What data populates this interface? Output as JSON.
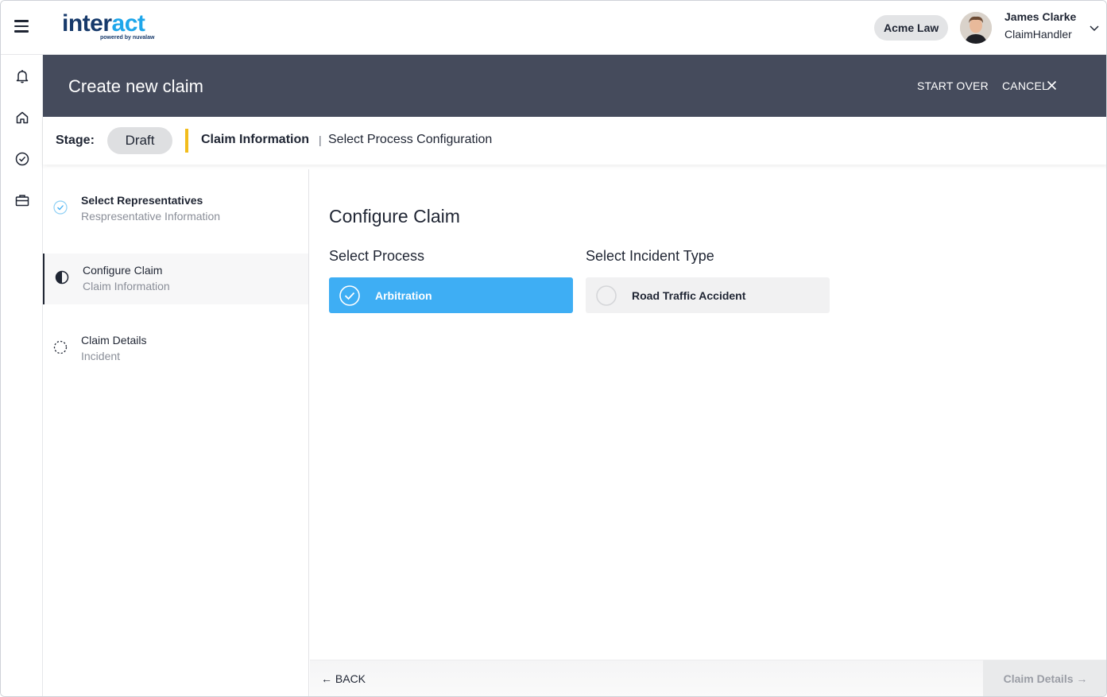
{
  "app": {
    "logo_primary": "inter",
    "logo_accent": "act",
    "logo_tagline": "powered by nuvalaw",
    "brand_colors": {
      "primary": "#173a6b",
      "accent": "#1ea6ea"
    }
  },
  "topbar": {
    "menu_icon": "hamburger-icon",
    "organization": "Acme Law",
    "user": {
      "name": "James Clarke",
      "role": "ClaimHandler"
    },
    "user_menu_icon": "chevron-down-icon"
  },
  "rail": {
    "items": [
      {
        "icon": "bell-icon"
      },
      {
        "icon": "home-icon"
      },
      {
        "icon": "check-circle-icon"
      },
      {
        "icon": "briefcase-icon"
      }
    ]
  },
  "header": {
    "title": "Create new claim",
    "start_over": "START OVER",
    "cancel": "CANCEL",
    "cancel_icon": "close-icon",
    "background": "#454b5c"
  },
  "stage": {
    "label": "Stage:",
    "value": "Draft",
    "accent": "#f2bd1d",
    "breadcrumb": [
      "Claim Information",
      "|",
      "Select Process Configuration"
    ]
  },
  "steps": [
    {
      "title": "Select Representatives",
      "subtitle": "Respresentative Information",
      "status": "complete",
      "icon": "check-circle-icon"
    },
    {
      "title": "Configure Claim",
      "subtitle": "Claim Information",
      "status": "in-progress",
      "icon": "half-circle-icon"
    },
    {
      "title": "Claim Details",
      "subtitle": "Incident",
      "status": "pending",
      "icon": "dashed-circle-icon"
    }
  ],
  "main": {
    "title": "Configure Claim",
    "process": {
      "label": "Select Process",
      "options": [
        {
          "label": "Arbitration",
          "selected": true
        }
      ]
    },
    "incident": {
      "label": "Select Incident Type",
      "options": [
        {
          "label": "Road Traffic Accident",
          "selected": false
        }
      ]
    },
    "selected_color": "#3eaef4"
  },
  "footer": {
    "back": "← BACK",
    "next": "Claim Details →"
  }
}
